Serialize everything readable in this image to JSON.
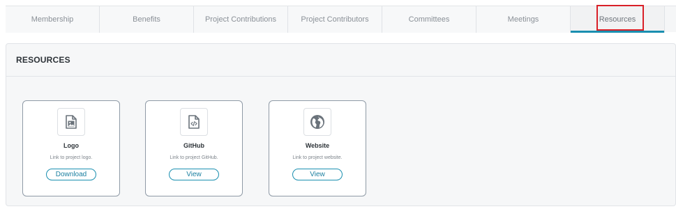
{
  "tabs": [
    {
      "label": "Membership",
      "active": false
    },
    {
      "label": "Benefits",
      "active": false
    },
    {
      "label": "Project Contributions",
      "active": false
    },
    {
      "label": "Project Contributors",
      "active": false
    },
    {
      "label": "Committees",
      "active": false
    },
    {
      "label": "Meetings",
      "active": false
    },
    {
      "label": "Resources",
      "active": true
    }
  ],
  "section": {
    "title": "RESOURCES"
  },
  "resources": [
    {
      "title": "Logo",
      "description": "Link to project logo.",
      "button": "Download",
      "icon": "image-file-icon"
    },
    {
      "title": "GitHub",
      "description": "Link to project GitHub.",
      "button": "View",
      "icon": "code-file-icon"
    },
    {
      "title": "Website",
      "description": "Link to project website.",
      "button": "View",
      "icon": "globe-icon"
    }
  ],
  "colors": {
    "accent": "#1a8fb0",
    "highlight": "#d92028",
    "card_border": "#8f9aa6"
  }
}
